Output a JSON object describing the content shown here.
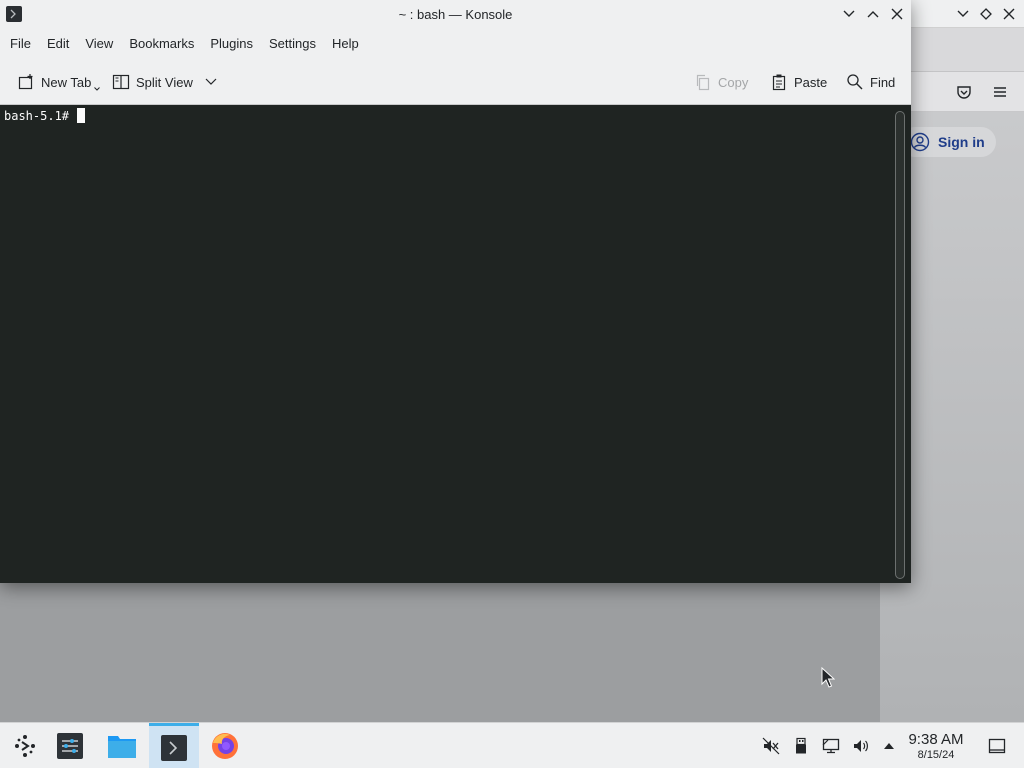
{
  "konsole": {
    "title": "~ : bash — Konsole",
    "menu": [
      "File",
      "Edit",
      "View",
      "Bookmarks",
      "Plugins",
      "Settings",
      "Help"
    ],
    "toolbar": {
      "new_tab": "New Tab",
      "split_view": "Split View",
      "copy": "Copy",
      "paste": "Paste",
      "find": "Find"
    },
    "terminal": {
      "prompt": "bash-5.1#"
    }
  },
  "browser": {
    "sign_in": "Sign in"
  },
  "taskbar": {
    "clock_time": "9:38 AM",
    "clock_date": "8/15/24"
  },
  "colors": {
    "terminal_bg": "#1f2422",
    "accent": "#3daee9",
    "chrome_bg": "#eff0f1"
  }
}
